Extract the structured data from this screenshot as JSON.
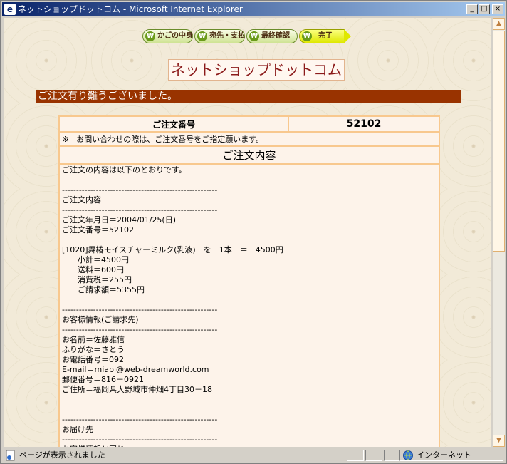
{
  "window": {
    "title": "ネットショップドットコム - Microsoft Internet Explorer",
    "app_icon": "ie-icon"
  },
  "steps": [
    {
      "label": "かごの中身"
    },
    {
      "label": "宛先・支払"
    },
    {
      "label": "最終確認"
    },
    {
      "label": "完了"
    }
  ],
  "shop_title": "ネットショップドットコム",
  "banner": "ご注文有り難うございました。",
  "order": {
    "number_label": "ご注文番号",
    "number_value": "52102",
    "note": "※　お問い合わせの際は、ご注文番号をご指定願います。",
    "content_title": "ご注文内容",
    "lines": [
      "ご注文の内容は以下のとおりです。",
      "",
      "-------------------------------------------------------",
      "ご注文内容",
      "-------------------------------------------------------",
      "ご注文年月日＝2004/01/25(日)",
      "ご注文番号＝52102",
      "",
      "[1020]舞椿モイスチャーミルク(乳液)　を　1本　＝　4500円",
      "　　小計＝4500円",
      "　　送料＝600円",
      "　　消費税＝255円",
      "　　ご請求額＝5355円",
      "",
      "-------------------------------------------------------",
      "お客様情報(ご請求先)",
      "-------------------------------------------------------",
      "お名前＝佐藤雅信",
      "ふりがな＝さとう",
      "お電話番号＝092",
      "E-mail＝miabi@web-dreamworld.com",
      "郵便番号＝816－0921",
      "ご住所＝福岡県大野城市仲畑4丁目30－18",
      "",
      "",
      "-------------------------------------------------------",
      "お届け先",
      "-------------------------------------------------------",
      "お客様情報と同じ"
    ]
  },
  "status": {
    "message": "ページが表示されました",
    "zone": "インターネット"
  },
  "colors": {
    "banner_bg": "#993300",
    "table_border": "#f8c88e",
    "title_bar": "#0a246a"
  }
}
